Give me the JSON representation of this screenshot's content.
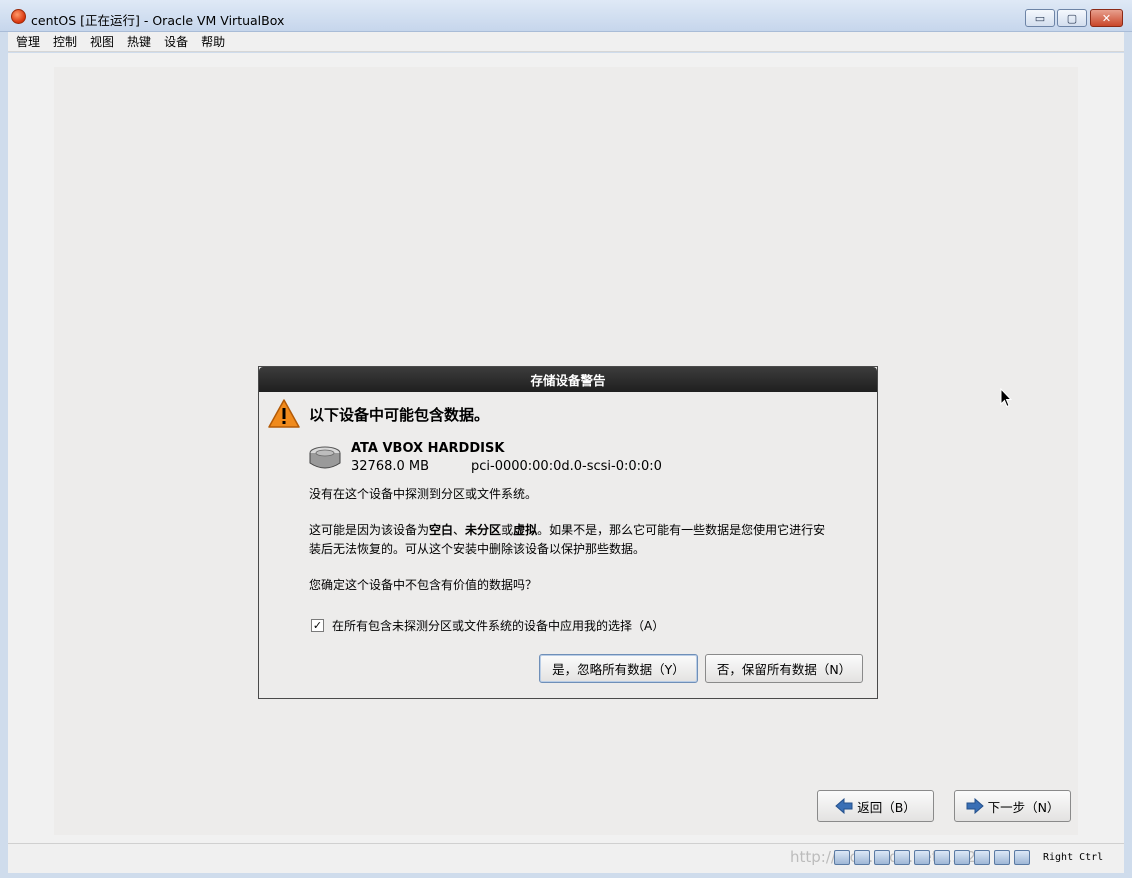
{
  "window": {
    "title": "centOS [正在运行] - Oracle VM VirtualBox",
    "minimize_glyph": "▭",
    "maximize_glyph": "▢",
    "close_glyph": "✕"
  },
  "menu": {
    "items": [
      "管理",
      "控制",
      "视图",
      "热键",
      "设备",
      "帮助"
    ]
  },
  "dialog": {
    "title": "存储设备警告",
    "heading": "以下设备中可能包含数据。",
    "disk": {
      "name": "ATA VBOX HARDDISK",
      "size": "32768.0 MB",
      "path": "pci-0000:00:0d.0-scsi-0:0:0:0"
    },
    "message1": "没有在这个设备中探测到分区或文件系统。",
    "message2_parts": {
      "p1": "这可能是因为该设备为",
      "b1": "空白",
      "p2": "、",
      "b2": "未分区",
      "p3": "或",
      "b3": "虚拟",
      "p4": "。如果不是，那么它可能有一些数据是您使用它进行安装后无法恢复的。可从这个安装中删除该设备以保护那些数据。"
    },
    "message3": "您确定这个设备中不包含有价值的数据吗？",
    "checkbox_label": "在所有包含未探测分区或文件系统的设备中应用我的选择（A）",
    "checkbox_checked": "✓",
    "yes_button": "是，忽略所有数据（Y）",
    "no_button": "否，保留所有数据（N）"
  },
  "installer": {
    "back_button": "返回（B）",
    "next_button": "下一步（N）"
  },
  "statusbar": {
    "watermark": "http://blog.csdn.net/...128",
    "host_key": "Right Ctrl"
  },
  "colors": {
    "warning": "#f08a1c",
    "arrow": "#3a6fb5"
  }
}
